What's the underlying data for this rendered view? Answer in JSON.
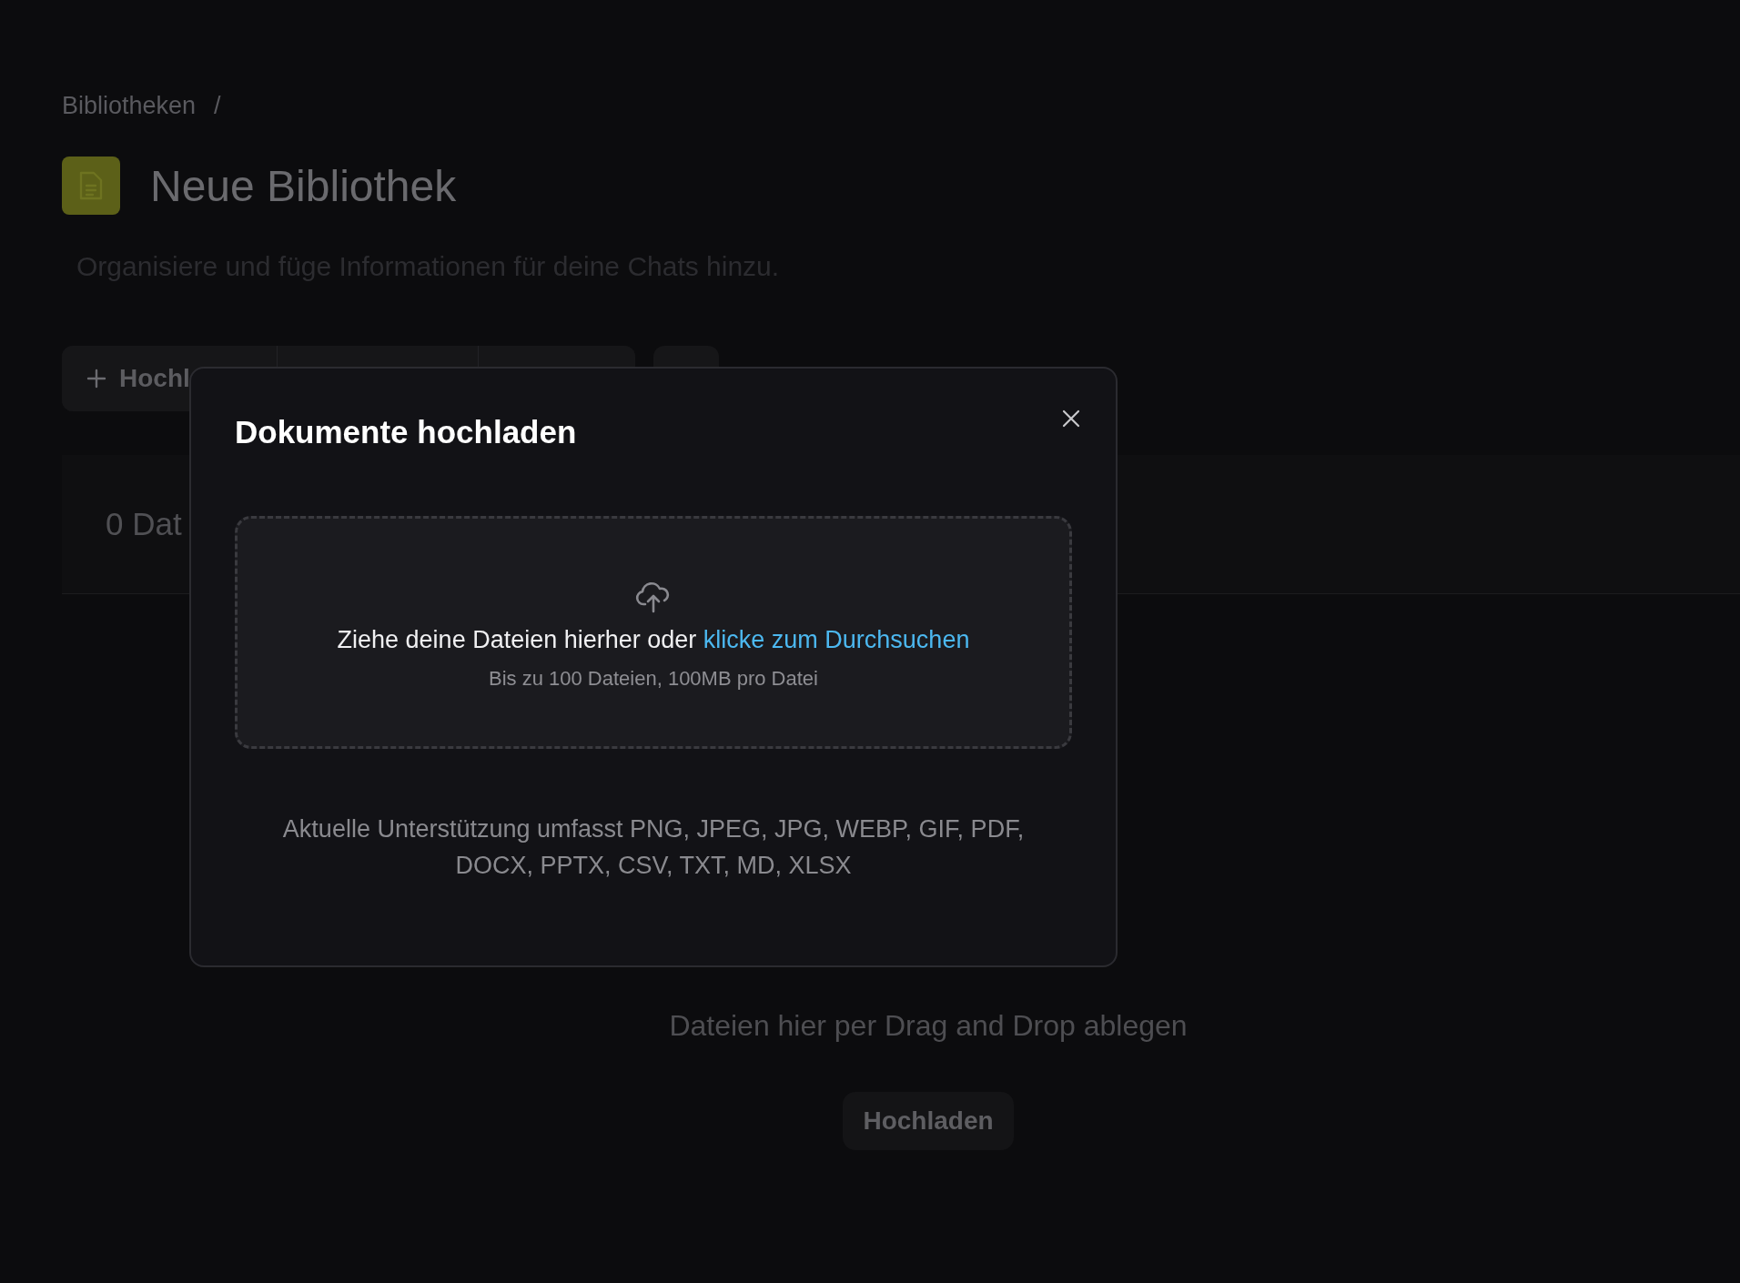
{
  "breadcrumb": {
    "items": [
      "Bibliotheken"
    ],
    "separator": "/"
  },
  "library": {
    "title": "Neue Bibliothek",
    "description": "Organisiere und füge Informationen für deine Chats hinzu."
  },
  "toolbar": {
    "first_button": {
      "label": "Hochl"
    }
  },
  "file_panel": {
    "count": "0 Dat"
  },
  "empty_state": {
    "message": "Dateien hier per Drag and Drop ablegen",
    "button": "Hochladen"
  },
  "dialog": {
    "title": "Dokumente hochladen",
    "dropzone": {
      "prompt": "Ziehe deine Dateien hierher oder",
      "link": "klicke zum Durchsuchen",
      "limits": "Bis zu 100 Dateien, 100MB pro Datei"
    },
    "support_note": "Aktuelle Unterstützung umfasst PNG, JPEG, JPG, WEBP, GIF, PDF, DOCX, PPTX, CSV, TXT, MD, XLSX"
  }
}
